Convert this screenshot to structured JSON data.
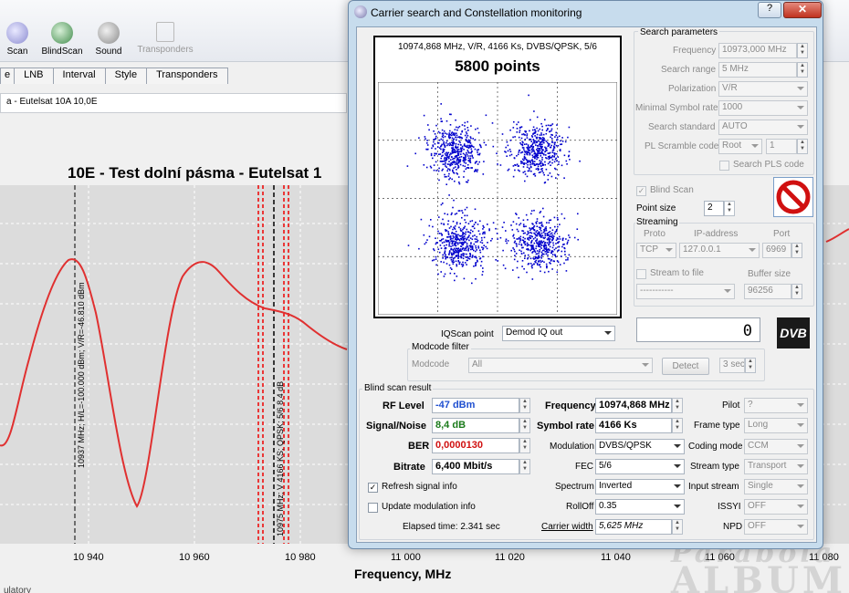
{
  "toolbar": {
    "items": [
      {
        "label": "Scan"
      },
      {
        "label": "BlindScan"
      },
      {
        "label": "Sound"
      },
      {
        "label": "Transponders"
      }
    ]
  },
  "tabs": [
    "e",
    "LNB",
    "Interval",
    "Style",
    "Transponders"
  ],
  "satellite_field": "a - Eutelsat 10A 10,0E",
  "plot": {
    "title": "10E - Test dolní pásma - Eutelsat 1",
    "xlabel": "Frequency, MHz",
    "x_ticks": [
      "10 940",
      "10 960",
      "10 980",
      "11 000",
      "11 020",
      "11 040",
      "11 060",
      "11 080"
    ],
    "marker1": "10937 MHz;  H/L=-100.000 dBm;  V/R=-46.810 dBm",
    "marker2": "10975 MHz; V 4166 KS; QPSK; 5/6  8.4 dB",
    "bottom_note": "ulatory"
  },
  "watermark": {
    "line1": "Parabola",
    "line2": "ALBUM"
  },
  "dialog": {
    "title": "Carrier search and Constellation monitoring",
    "help": "?",
    "close": "✕",
    "constellation": {
      "header": "10974,868 MHz, V/R, 4166 Ks, DVBS/QPSK, 5/6",
      "points": "5800 points"
    },
    "search": {
      "group": "Search parameters",
      "frequency_label": "Frequency",
      "frequency": "10973,000 MHz",
      "range_label": "Search range",
      "range": "5 MHz",
      "polarization_label": "Polarization",
      "polarization": "V/R",
      "min_sr_label": "Minimal Symbol rate",
      "min_sr": "1000",
      "standard_label": "Search standard",
      "standard": "AUTO",
      "pls_label": "PL Scramble code",
      "pls_mode": "Root",
      "pls_value": "1",
      "pls_search": "Search PLS code"
    },
    "blind_scan": "Blind Scan",
    "point_size_label": "Point size",
    "point_size": "2",
    "streaming": {
      "group": "Streaming",
      "proto_label": "Proto",
      "ip_label": "IP-address",
      "port_label": "Port",
      "proto": "TCP",
      "ip": "127.0.0.1",
      "port": "6969",
      "to_file": "Stream to file",
      "buffer_label": "Buffer size",
      "file": "-----------",
      "buffer": "96256"
    },
    "counter": "0",
    "dvb_logo": "DVB",
    "iqscan_label": "IQScan point",
    "iqscan": "Demod IQ out",
    "modcode": {
      "group": "Modcode filter",
      "label": "Modcode",
      "value": "All",
      "detect": "Detect",
      "interval": "3 sec"
    },
    "result": {
      "group": "Blind scan result",
      "rf_label": "RF Level",
      "rf": "-47 dBm",
      "sn_label": "Signal/Noise",
      "sn": "8,4 dB",
      "ber_label": "BER",
      "ber": "0,0000130",
      "bitrate_label": "Bitrate",
      "bitrate": "6,400 Mbit/s",
      "freq_label": "Frequency",
      "freq": "10974,868 MHz",
      "sr_label": "Symbol rate",
      "sr": "4166 Ks",
      "mod_label": "Modulation",
      "mod": "DVBS/QPSK",
      "fec_label": "FEC",
      "fec": "5/6",
      "spectrum_label": "Spectrum",
      "spectrum": "Inverted",
      "rolloff_label": "RollOff",
      "rolloff": "0.35",
      "cw_label": "Carrier width",
      "cw": "5,625 MHz",
      "pilot_label": "Pilot",
      "pilot": "?",
      "frame_label": "Frame type",
      "frame": "Long",
      "coding_label": "Coding mode",
      "coding": "CCM",
      "stream_label": "Stream type",
      "stream": "Transport",
      "input_label": "Input stream",
      "input": "Single",
      "issyi_label": "ISSYI",
      "issyi": "OFF",
      "npd_label": "NPD",
      "npd": "OFF",
      "refresh": "Refresh signal info",
      "update": "Update modulation info",
      "elapsed": "Elapsed time: 2.341 sec"
    }
  },
  "colors": {
    "rf": "#1f4fd0",
    "sn": "#1a7a1a",
    "ber": "#d01010",
    "curve": "#e03030",
    "points": "#0000cc"
  }
}
